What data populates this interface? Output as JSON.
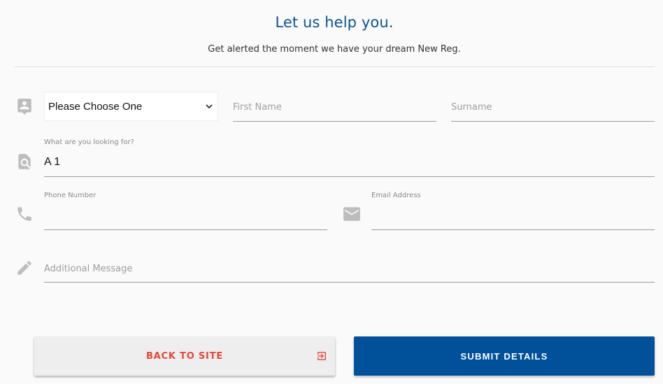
{
  "header": {
    "title": "Let us help you.",
    "subtitle": "Get alerted the moment we have your dream New Reg."
  },
  "form": {
    "title_select": {
      "selected": "Please Choose One",
      "options": [
        "Please Choose One"
      ]
    },
    "first_name": {
      "placeholder": "First Name",
      "value": ""
    },
    "surname": {
      "placeholder": "Surname",
      "value": ""
    },
    "looking_for": {
      "label": "What are you looking for?",
      "value": "A 1"
    },
    "phone": {
      "label": "Phone Number",
      "value": ""
    },
    "email": {
      "label": "Email Address",
      "value": ""
    },
    "message": {
      "placeholder": "Additional Message",
      "value": ""
    }
  },
  "icons": {
    "title": "contact-icon",
    "looking_for": "search-document-icon",
    "phone": "phone-icon",
    "email": "mail-icon",
    "message": "pencil-icon",
    "back": "exit-to-app-icon"
  },
  "buttons": {
    "back_label": "BACK TO SITE",
    "submit_label": "SUBMIT DETAILS"
  },
  "colors": {
    "title": "#0b5394",
    "submit_bg": "#00519a",
    "back_text": "#e8463a",
    "back_bg": "#eeeeee",
    "icon": "#bdbdbd"
  }
}
